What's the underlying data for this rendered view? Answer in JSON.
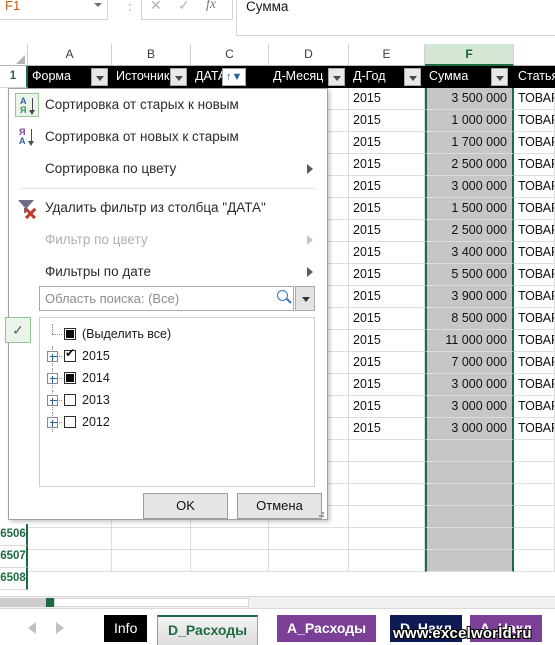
{
  "formula_bar": {
    "name_box": "F1",
    "separator": ":",
    "cancel_icon": "x-icon",
    "enter_icon": "check-icon",
    "function_icon": "fx-icon",
    "formula_value": "Сумма"
  },
  "columns": [
    {
      "letter": "A",
      "selected": false
    },
    {
      "letter": "B",
      "selected": false
    },
    {
      "letter": "C",
      "selected": false
    },
    {
      "letter": "D",
      "selected": false
    },
    {
      "letter": "E",
      "selected": false
    },
    {
      "letter": "F",
      "selected": true
    }
  ],
  "table_headers": [
    {
      "label": "Форма",
      "filter": "dropdown"
    },
    {
      "label": "Источник",
      "filter": "dropdown"
    },
    {
      "label": "ДАТА",
      "filter": "sorted-filtered"
    },
    {
      "label": "Д-Месяц",
      "filter": "dropdown"
    },
    {
      "label": "Д-Год",
      "filter": "dropdown"
    },
    {
      "label": "Сумма",
      "filter": "dropdown"
    },
    {
      "label": "Статья",
      "filter": "none"
    }
  ],
  "header_row_number": "1",
  "rows": [
    {
      "year": "2015",
      "amount": "3 500 000",
      "article": "ТОВАР"
    },
    {
      "year": "2015",
      "amount": "1 000 000",
      "article": "ТОВАР"
    },
    {
      "year": "2015",
      "amount": "1 700 000",
      "article": "ТОВАР"
    },
    {
      "year": "2015",
      "amount": "2 500 000",
      "article": "ТОВАР"
    },
    {
      "year": "2015",
      "amount": "3 000 000",
      "article": "ТОВАР"
    },
    {
      "year": "2015",
      "amount": "1 500 000",
      "article": "ТОВАР"
    },
    {
      "year": "2015",
      "amount": "2 500 000",
      "article": "ТОВАР"
    },
    {
      "year": "2015",
      "amount": "3 400 000",
      "article": "ТОВАР"
    },
    {
      "year": "2015",
      "amount": "5 500 000",
      "article": "ТОВАР"
    },
    {
      "year": "2015",
      "amount": "3 900 000",
      "article": "ТОВАР"
    },
    {
      "year": "2015",
      "amount": "8 500 000",
      "article": "ТОВАР"
    },
    {
      "year": "2015",
      "amount": "11 000 000",
      "article": "ТОВАР"
    },
    {
      "year": "2015",
      "amount": "7 000 000",
      "article": "ТОВАР"
    },
    {
      "year": "2015",
      "amount": "3 000 000",
      "article": "ТОВАР"
    },
    {
      "year": "2015",
      "amount": "3 000 000",
      "article": "ТОВАР"
    },
    {
      "year": "2015",
      "amount": "3 000 000",
      "article": "ТОВАР"
    }
  ],
  "visible_row_numbers": [
    "6506",
    "6507",
    "6508"
  ],
  "filter_menu": {
    "items": [
      {
        "label": "Сортировка от старых к новым",
        "accel": "С",
        "icon": "sort-ascending-icon",
        "disabled": false,
        "submenu": false
      },
      {
        "label": "Сортировка от новых к старым",
        "accel": "н",
        "icon": "sort-descending-icon",
        "disabled": false,
        "submenu": false
      },
      {
        "label": "Сортировка по цвету",
        "accel": "С",
        "icon": "none",
        "disabled": false,
        "submenu": true
      },
      {
        "label": "Удалить фильтр из столбца \"ДАТА\"",
        "accel": "У",
        "icon": "clear-filter-icon",
        "disabled": false,
        "submenu": false
      },
      {
        "label": "Фильтр по цвету",
        "accel": "Ф",
        "icon": "none",
        "disabled": true,
        "submenu": true
      },
      {
        "label": "Фильтры по дате",
        "accel": "Ф",
        "icon": "none",
        "disabled": false,
        "submenu": true
      }
    ],
    "search": {
      "placeholder": "Область поиска: (Все)",
      "value": "Область поиска: (Все)",
      "search_icon": "magnifier-icon",
      "dropdown_icon": "chevron-down-icon"
    },
    "apply_check_icon": "checkmark-icon",
    "tree": [
      {
        "label": "(Выделить все)",
        "state": "partial",
        "expandable": false
      },
      {
        "label": "2015",
        "state": "checked",
        "expandable": true
      },
      {
        "label": "2014",
        "state": "partial",
        "expandable": true
      },
      {
        "label": "2013",
        "state": "unchecked",
        "expandable": true
      },
      {
        "label": "2012",
        "state": "unchecked",
        "expandable": true
      }
    ],
    "buttons": {
      "ok": "OK",
      "cancel": "Отмена"
    }
  },
  "sheet_tabs": [
    {
      "label": "Info",
      "style": "info",
      "active": false
    },
    {
      "label": "D_Расходы",
      "style": "active",
      "active": true
    },
    {
      "label": "A_Расходы",
      "style": "purple",
      "active": false
    },
    {
      "label": "D_Накл",
      "style": "navy",
      "active": false
    },
    {
      "label": "A_Накл",
      "style": "purple",
      "active": false
    }
  ],
  "nav": {
    "prev_icon": "triangle-left-icon",
    "next_icon": "triangle-right-icon"
  },
  "watermark": "www.excelworld.ru",
  "colors": {
    "accent_green": "#1e6b41",
    "header_black": "#000000",
    "selected_col": "#c6c6c6",
    "purple_tab": "#7b3f98",
    "navy_tab": "#0d1a54"
  }
}
